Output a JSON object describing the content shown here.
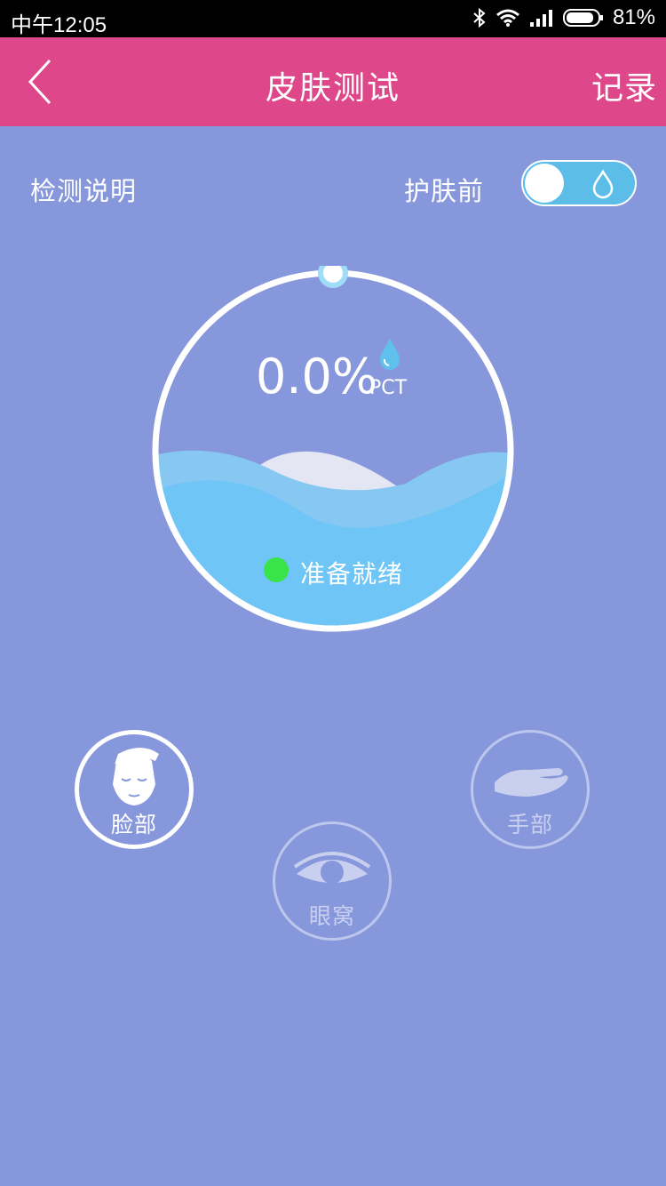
{
  "status_bar": {
    "time": "中午12:05",
    "battery": "81%"
  },
  "nav": {
    "title": "皮肤测试",
    "record_label": "记录"
  },
  "controls": {
    "instructions_label": "检测说明",
    "mode_label": "护肤前"
  },
  "gauge": {
    "value": "0.0%",
    "unit": "PCT",
    "level": 0.0,
    "status": "准备就绪"
  },
  "zones": {
    "face": {
      "label": "脸部"
    },
    "eye": {
      "label": "眼窝"
    },
    "hand": {
      "label": "手部"
    }
  },
  "colors": {
    "nav": "#de488a",
    "background": "#8797dc",
    "water": "#6fc6f6",
    "ready": "#39e34a"
  }
}
